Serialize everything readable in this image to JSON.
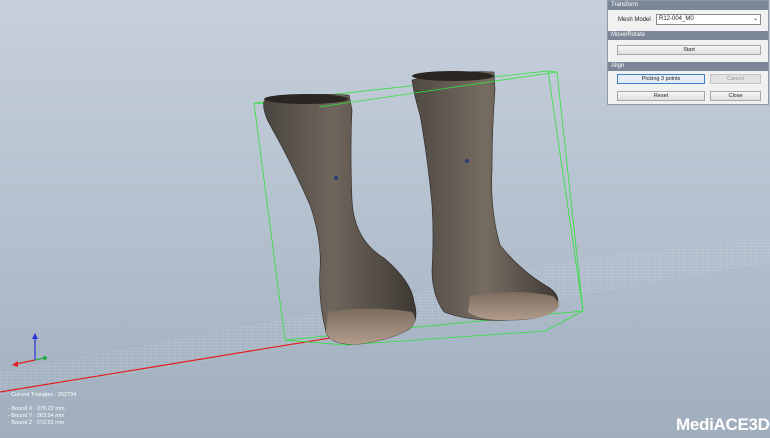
{
  "panel": {
    "transform_title": "Transform",
    "mesh_model_label": "Mesh Model",
    "mesh_model_value": "R12-004_M0",
    "move_rotate_title": "Move/Rotate",
    "start_label": "Start",
    "align_title": "Align",
    "picking_label": "Picking 3 points",
    "cancel_label": "Cancel",
    "reset_label": "Reset",
    "close_label": "Close"
  },
  "stats": {
    "current_triangles": "Current Triangles : 252734",
    "bound_x": "- Bound X : 270.22 mm",
    "bound_y": "- Bound Y : 263.54 mm",
    "bound_z": "- Bound Z : 272.53 mm"
  },
  "logo": {
    "text": "MediACE3D"
  },
  "colors": {
    "bounding_box": "#2fe23a",
    "axis_x": "#e02020",
    "axis_y": "#2aa84a",
    "axis_z": "#2a35d8",
    "panel_header": "#7b8797"
  },
  "icons": {
    "dropdown": "chevron-down-icon",
    "axes": "axes-gizmo-icon"
  }
}
